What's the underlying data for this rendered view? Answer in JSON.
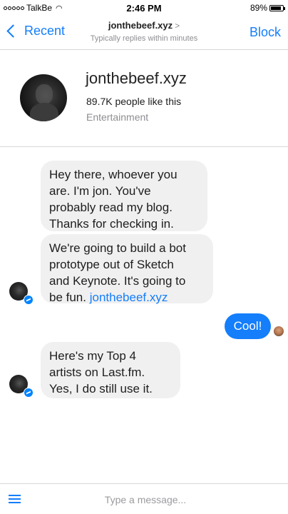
{
  "status_bar": {
    "carrier": "TalkBe",
    "time": "2:46 PM",
    "battery_percent": "89%",
    "battery_level": 0.89,
    "signal_bars_filled": 0,
    "signal_bars_total": 5,
    "icons": [
      "wifi-icon",
      "battery-icon"
    ]
  },
  "nav": {
    "back_label": "Recent",
    "title": "jonthebeef.xyz",
    "subtitle": "Typically replies within minutes",
    "block_label": "Block",
    "accent_color": "#147efb"
  },
  "profile": {
    "name": "jonthebeef.xyz",
    "likes": "89.7K people like this",
    "category": "Entertainment"
  },
  "messages": [
    {
      "from": "page",
      "text": [
        "Hey there, whoever you",
        "are. I'm jon. You've",
        "probably read my blog.",
        "Thanks for checking in."
      ]
    },
    {
      "from": "page",
      "text": [
        "We're going to build a bot",
        "prototype out of Sketch",
        "and Keynote. It's going to",
        "be fun. "
      ],
      "link": "jonthebeef.xyz"
    },
    {
      "from": "user",
      "text": "Cool!"
    },
    {
      "from": "page",
      "text": [
        "Here's my Top 4",
        "artists on Last.fm.",
        "Yes, I do still use it."
      ]
    }
  ],
  "composer": {
    "placeholder": "Type a message...",
    "value": "",
    "menu_icon": "hamburger-menu-icon"
  },
  "colors": {
    "page_bubble": "#f1f0f0",
    "user_bubble": "#147efb",
    "messenger_badge": "#0084ff"
  }
}
